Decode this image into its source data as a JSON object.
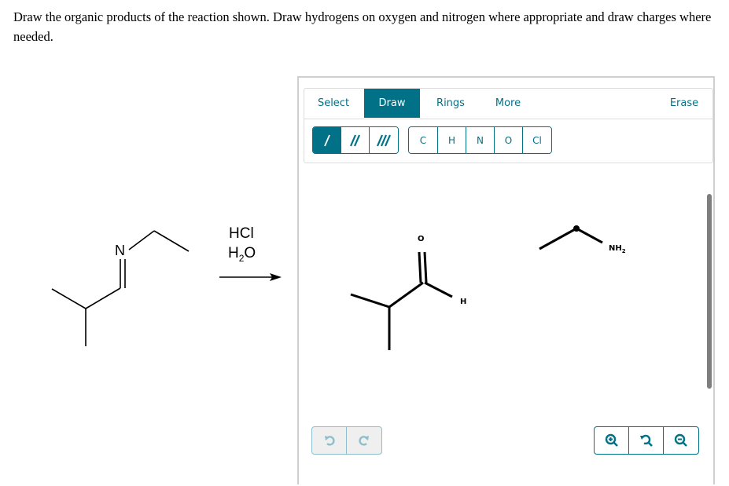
{
  "question": {
    "text": "Draw the organic products of the reaction shown. Draw hydrogens on oxygen and nitrogen where appropriate and draw charges where needed."
  },
  "reaction": {
    "reactant_atom_label": "N",
    "reagents": [
      {
        "main": "HCl",
        "sub": "",
        "tail": ""
      },
      {
        "main": "H",
        "sub": "2",
        "tail": "O"
      }
    ]
  },
  "editor": {
    "tabs": [
      {
        "label": "Select",
        "active": false
      },
      {
        "label": "Draw",
        "active": true
      },
      {
        "label": "Rings",
        "active": false
      },
      {
        "label": "More",
        "active": false
      },
      {
        "label": "Erase",
        "active": false
      }
    ],
    "bond_tools": [
      {
        "name": "single-bond",
        "active": true
      },
      {
        "name": "double-bond",
        "active": false
      },
      {
        "name": "triple-bond",
        "active": false
      }
    ],
    "atom_tools": [
      "C",
      "H",
      "N",
      "O",
      "Cl"
    ],
    "canvas": {
      "product1_atoms": {
        "oxygen": "O",
        "hydrogen": "H"
      },
      "product2_atoms": {
        "amine": "NH",
        "amine_sub": "2"
      }
    },
    "bottom_left": [
      {
        "name": "undo",
        "icon": "undo-icon"
      },
      {
        "name": "redo",
        "icon": "redo-icon"
      }
    ],
    "bottom_right": [
      {
        "name": "zoom-in",
        "icon": "zoom-in-icon"
      },
      {
        "name": "reset-zoom",
        "icon": "reset-zoom-icon"
      },
      {
        "name": "zoom-out",
        "icon": "zoom-out-icon"
      }
    ],
    "colors": {
      "accent": "#007187",
      "disabled_accent": "#8cbfcb",
      "scrollbar": "#7e7e7e",
      "panel_border": "#cfcfcf"
    }
  }
}
